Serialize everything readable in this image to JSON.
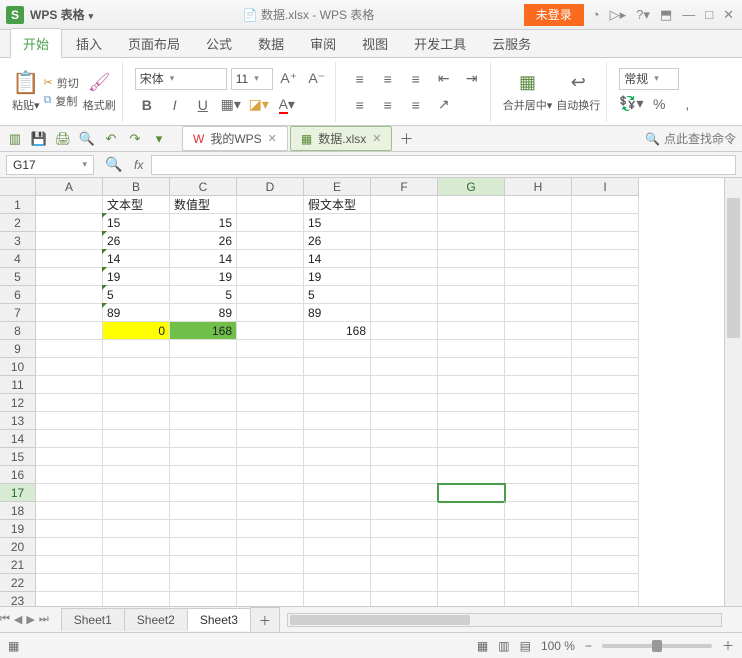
{
  "title": {
    "app": "WPS 表格",
    "doc": "数据.xlsx - WPS 表格",
    "login": "未登录"
  },
  "menu": [
    "开始",
    "插入",
    "页面布局",
    "公式",
    "数据",
    "审阅",
    "视图",
    "开发工具",
    "云服务"
  ],
  "ribbon": {
    "paste": "粘贴",
    "cut": "剪切",
    "copy": "复制",
    "fmt": "格式刷",
    "font": "宋体",
    "size": "11",
    "merge": "合并居中",
    "wrap": "自动换行",
    "general": "常规"
  },
  "docTabs": {
    "a": "我的WPS",
    "b": "数据.xlsx"
  },
  "search": "点此查找命令",
  "nameBox": "G17",
  "cols": [
    "A",
    "B",
    "C",
    "D",
    "E",
    "F",
    "G",
    "H",
    "I"
  ],
  "rows": 23,
  "hdr": {
    "b": "文本型",
    "c": "数值型",
    "e": "假文本型"
  },
  "b": [
    "15",
    "26",
    "14",
    "19",
    "5",
    "89"
  ],
  "c": [
    "15",
    "26",
    "14",
    "19",
    "5",
    "89"
  ],
  "e": [
    "15",
    "26",
    "14",
    "19",
    "5",
    "89"
  ],
  "b8": "0",
  "c8": "168",
  "e8": "168",
  "sheets": [
    "Sheet1",
    "Sheet2",
    "Sheet3"
  ],
  "zoom": "100 %",
  "chart_data": {
    "type": "table",
    "columns": [
      "B 文本型",
      "C 数值型",
      "E 假文本型"
    ],
    "rows": [
      [
        "15",
        15,
        "15"
      ],
      [
        "26",
        26,
        "26"
      ],
      [
        "14",
        14,
        "14"
      ],
      [
        "19",
        19,
        "19"
      ],
      [
        "5",
        5,
        "5"
      ],
      [
        "89",
        89,
        "89"
      ],
      [
        0,
        168,
        168
      ]
    ]
  }
}
